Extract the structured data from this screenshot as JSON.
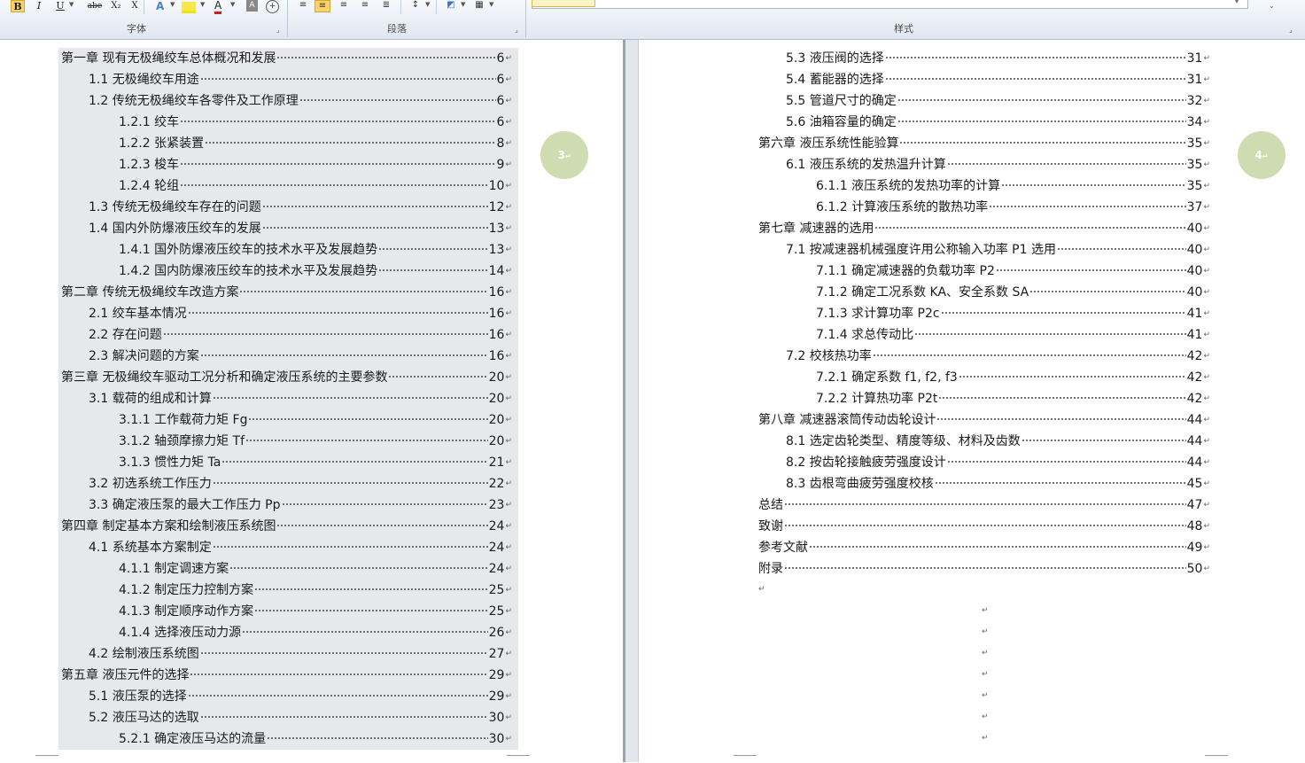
{
  "ribbon": {
    "font_buttons": [
      "B",
      "I",
      "U",
      "abe",
      "X₂",
      "X"
    ],
    "font_group_label": "字体",
    "paragraph_group_label": "段落",
    "styles_group_label": "样式"
  },
  "pages": [
    {
      "page_number": "3",
      "entries": [
        {
          "label": "第一章  现有无极绳绞车总体概况和发展",
          "page": "6"
        },
        {
          "label": "1.1  无极绳绞车用途",
          "page": "6"
        },
        {
          "label": "1.2  传统无极绳绞车各零件及工作原理",
          "page": "6"
        },
        {
          "label": "1.2.1  绞车",
          "page": "6"
        },
        {
          "label": "1.2.2  张紧装置",
          "page": "8"
        },
        {
          "label": "1.2.3  梭车",
          "page": "9"
        },
        {
          "label": "1.2.4  轮组",
          "page": "10"
        },
        {
          "label": "1.3  传统无极绳绞车存在的问题",
          "page": "12"
        },
        {
          "label": "1.4  国内外防爆液压绞车的发展",
          "page": "13"
        },
        {
          "label": "1.4.1  国外防爆液压绞车的技术水平及发展趋势",
          "page": "13"
        },
        {
          "label": "1.4.2  国内防爆液压绞车的技术水平及发展趋势",
          "page": "14"
        },
        {
          "label": "第二章  传统无极绳绞车改造方案",
          "page": "16"
        },
        {
          "label": "2.1 绞车基本情况",
          "page": "16"
        },
        {
          "label": "2.2  存在问题",
          "page": "16"
        },
        {
          "label": "2.3  解决问题的方案",
          "page": "16"
        },
        {
          "label": "第三章  无极绳绞车驱动工况分析和确定液压系统的主要参数",
          "page": "20"
        },
        {
          "label": "3.1  载荷的组成和计算",
          "page": "20"
        },
        {
          "label": "3.1.1  工作载荷力矩 Fg",
          "page": "20"
        },
        {
          "label": "3.1.2  轴颈摩擦力矩 Tf",
          "page": "20"
        },
        {
          "label": "3.1.3  惯性力矩 Ta",
          "page": "21"
        },
        {
          "label": "3.2  初选系统工作压力",
          "page": "22"
        },
        {
          "label": "3.3  确定液压泵的最大工作压力 Pp",
          "page": "23"
        },
        {
          "label": "第四章  制定基本方案和绘制液压系统图",
          "page": "24"
        },
        {
          "label": "4.1  系统基本方案制定",
          "page": "24"
        },
        {
          "label": "4.1.1  制定调速方案",
          "page": "24"
        },
        {
          "label": "4.1.2  制定压力控制方案",
          "page": "25"
        },
        {
          "label": "4.1.3  制定顺序动作方案",
          "page": "25"
        },
        {
          "label": "4.1.4  选择液压动力源",
          "page": "26"
        },
        {
          "label": "4.2  绘制液压系统图",
          "page": "27"
        },
        {
          "label": "第五章  液压元件的选择",
          "page": "29"
        },
        {
          "label": "5.1  液压泵的选择",
          "page": "29"
        },
        {
          "label": "5.2  液压马达的选取",
          "page": "30"
        },
        {
          "label": "5.2.1  确定液压马达的流量",
          "page": "30"
        }
      ]
    },
    {
      "page_number": "4",
      "entries": [
        {
          "label": "5.3  液压阀的选择",
          "page": "31"
        },
        {
          "label": "5.4  蓄能器的选择",
          "page": "31"
        },
        {
          "label": "5.5  管道尺寸的确定",
          "page": "32"
        },
        {
          "label": "5.6  油箱容量的确定",
          "page": "34"
        },
        {
          "label": "第六章  液压系统性能验算",
          "page": "35"
        },
        {
          "label": "6.1  液压系统的发热温升计算",
          "page": "35"
        },
        {
          "label": "6.1.1  液压系统的发热功率的计算",
          "page": "35"
        },
        {
          "label": "6.1.2  计算液压系统的散热功率",
          "page": "37"
        },
        {
          "label": "第七章  减速器的选用",
          "page": "40"
        },
        {
          "label": "7.1  按减速器机械强度许用公称输入功率 P1 选用",
          "page": "40"
        },
        {
          "label": "7.1.1  确定减速器的负载功率 P2",
          "page": "40"
        },
        {
          "label": "7.1.2  确定工况系数 KA、安全系数 SA",
          "page": "40"
        },
        {
          "label": "7.1.3  求计算功率 P2c",
          "page": "41"
        },
        {
          "label": "7.1.4  求总传动比",
          "page": "41"
        },
        {
          "label": "7.2  校核热功率",
          "page": "42"
        },
        {
          "label": "7.2.1  确定系数 f1, f2, f3",
          "page": "42"
        },
        {
          "label": "7.2.2  计算热功率 P2t",
          "page": "42"
        },
        {
          "label": "第八章  减速器滚筒传动齿轮设计",
          "page": "44"
        },
        {
          "label": "8.1  选定齿轮类型、精度等级、材料及齿数",
          "page": "44"
        },
        {
          "label": "8.2  按齿轮接触疲劳强度设计",
          "page": "44"
        },
        {
          "label": "8.3  齿根弯曲疲劳强度校核",
          "page": "45"
        },
        {
          "label": "总结",
          "page": "47"
        },
        {
          "label": "致谢",
          "page": "48"
        },
        {
          "label": "参考文献",
          "page": "49"
        },
        {
          "label": "附录",
          "page": "50"
        }
      ]
    }
  ],
  "paragraph_mark": "↵",
  "colors": {
    "toc_highlight": "#e6e8ec",
    "page_bubble": "#cfdcb1",
    "ribbon_active": "#f7d36b"
  }
}
